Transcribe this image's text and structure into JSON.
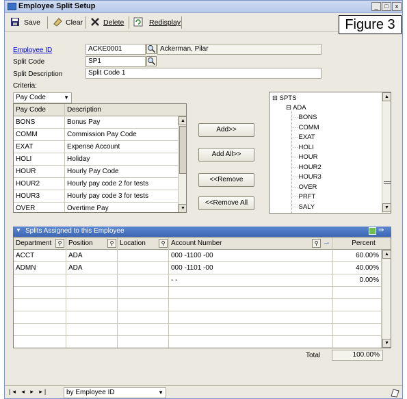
{
  "window": {
    "title": "Employee Split Setup"
  },
  "figure_label": "Figure 3",
  "toolbar": {
    "save": "Save",
    "clear": "Clear",
    "delete": "Delete",
    "redisplay": "Redisplay"
  },
  "form": {
    "employee_id_label": "Employee ID",
    "employee_id": "ACKE0001",
    "employee_name": "Ackerman, Pilar",
    "split_code_label": "Split Code",
    "split_code": "SP1",
    "split_desc_label": "Split Description",
    "split_desc": "Split Code 1",
    "criteria_label": "Criteria:",
    "criteria_value": "Pay Code"
  },
  "paycodes": {
    "headers": [
      "Pay Code",
      "Description"
    ],
    "rows": [
      [
        "BONS",
        "Bonus Pay"
      ],
      [
        "COMM",
        "Commission Pay Code"
      ],
      [
        "EXAT",
        "Expense Account"
      ],
      [
        "HOLI",
        "Holiday"
      ],
      [
        "HOUR",
        "Hourly Pay Code"
      ],
      [
        "HOUR2",
        "Hourly pay code 2 for tests"
      ],
      [
        "HOUR3",
        "Hourly pay code 3 for tests"
      ],
      [
        "OVER",
        "Overtime Pay"
      ]
    ]
  },
  "buttons": {
    "add": "Add>>",
    "add_all": "Add All>>",
    "remove": "<<Remove",
    "remove_all": "<<Remove All"
  },
  "tree": {
    "root": "SPTS",
    "node": "ADA",
    "items": [
      "BONS",
      "COMM",
      "EXAT",
      "HOLI",
      "HOUR",
      "HOUR2",
      "HOUR3",
      "OVER",
      "PRFT",
      "SALY"
    ]
  },
  "splits": {
    "title": "Splits Assigned to this Employee",
    "headers": [
      "Department",
      "Position",
      "Location",
      "Account Number",
      "Percent"
    ],
    "rows": [
      [
        "ACCT",
        "ADA",
        "",
        "000 -1100 -00",
        "60.00%"
      ],
      [
        "ADMN",
        "ADA",
        "",
        "000 -1101 -00",
        "40.00%"
      ],
      [
        "",
        "",
        "",
        "  -      -",
        "0.00%"
      ],
      [
        "",
        "",
        "",
        "",
        ""
      ],
      [
        "",
        "",
        "",
        "",
        ""
      ],
      [
        "",
        "",
        "",
        "",
        ""
      ],
      [
        "",
        "",
        "",
        "",
        ""
      ],
      [
        "",
        "",
        "",
        "",
        ""
      ]
    ],
    "total_label": "Total",
    "total_value": "100.00%"
  },
  "status": {
    "sort_value": "by Employee ID"
  },
  "colors": {
    "title_gradient": "#b7c9ea",
    "splits_header": "#3e67b4",
    "link": "#0000cc"
  }
}
